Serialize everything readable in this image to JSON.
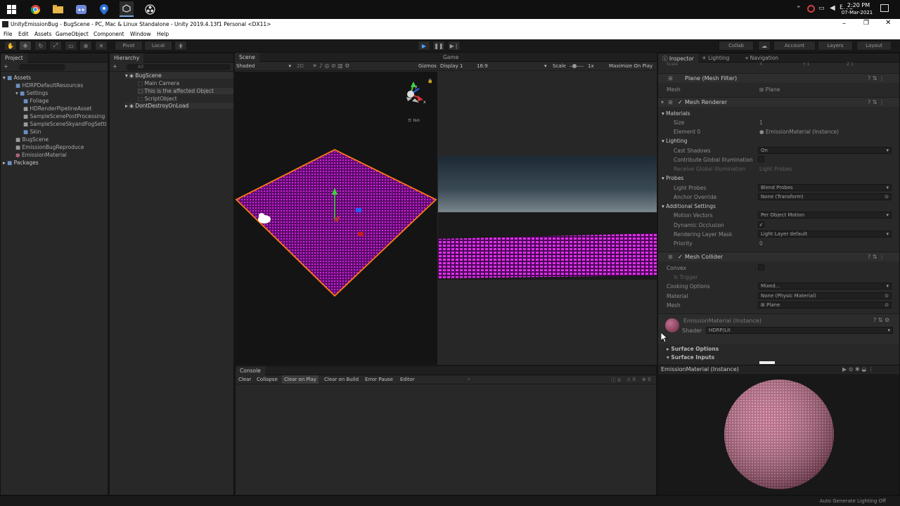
{
  "taskbar": {
    "time": "2:20 PM",
    "date": "07-Mar-2021"
  },
  "window": {
    "title": "UnityEmissionBug - BugScene - PC, Mac & Linux Standalone - Unity 2019.4.13f1 Personal <DX11>"
  },
  "menu": [
    "File",
    "Edit",
    "Assets",
    "GameObject",
    "Component",
    "Window",
    "Help"
  ],
  "toolbar": {
    "pivot": "Pivot",
    "local": "Local",
    "collab": "Collab",
    "account": "Account",
    "layers": "Layers",
    "layout": "Layout"
  },
  "project": {
    "tab": "Project",
    "assets": "Assets",
    "items": [
      "HDRPDefaultResources",
      "Settings",
      "Foliage",
      "HDRenderPipelineAsset",
      "SampleScenePostProcessing",
      "SampleSceneSkyandFogSetti",
      "Skin",
      "BugScene",
      "EmissionBugReproduce",
      "EmissionMaterial"
    ],
    "packages": "Packages"
  },
  "hierarchy": {
    "tab": "Hierarchy",
    "search": "All",
    "scene": "BugScene",
    "items": [
      "Main Camera",
      "This is the affected Object",
      "ScriptObject"
    ],
    "ddol": "DontDestroyOnLoad"
  },
  "scene": {
    "tab": "Scene",
    "mode": "Shaded",
    "dim": "2D",
    "gizmos": "Gizmos",
    "iso": "Iso",
    "axis_x": "x",
    "axis_y": "y"
  },
  "game": {
    "tab": "Game",
    "display": "Display 1",
    "aspect": "16:9",
    "scale": "Scale",
    "scale_val": "1x",
    "maximize": "Maximize On Play"
  },
  "console": {
    "tab": "Console",
    "clear": "Clear",
    "collapse": "Collapse",
    "clear_on_play": "Clear on Play",
    "clear_on_build": "Clear on Build",
    "error_pause": "Error Pause",
    "editor": "Editor",
    "c1": "0",
    "c2": "0",
    "c3": "0"
  },
  "inspector": {
    "tabs": [
      "Inspector",
      "Lighting",
      "Navigation"
    ],
    "top": {
      "x": "X",
      "y": "Y 1",
      "z": "Z 1",
      "scale": "Scale"
    },
    "mesh_filter": {
      "title": "Plane (Mesh Filter)",
      "mesh_label": "Mesh",
      "mesh_val": "Plane"
    },
    "mesh_renderer": {
      "title": "Mesh Renderer",
      "materials": "Materials",
      "size_label": "Size",
      "size_val": "1",
      "elem_label": "Element 0",
      "elem_val": "EmissionMaterial (Instance)",
      "lighting": "Lighting",
      "cast_label": "Cast Shadows",
      "cast_val": "On",
      "contrib_label": "Contribute Global Illumination",
      "receive_label": "Receive Global Illumination",
      "receive_val": "Light Probes",
      "probes": "Probes",
      "lp_label": "Light Probes",
      "lp_val": "Blend Probes",
      "anchor_label": "Anchor Override",
      "anchor_val": "None (Transform)",
      "additional": "Additional Settings",
      "mv_label": "Motion Vectors",
      "mv_val": "Per Object Motion",
      "dyn_label": "Dynamic Occlusion",
      "rlm_label": "Rendering Layer Mask",
      "rlm_val": "Light Layer default",
      "prio_label": "Priority",
      "prio_val": "0"
    },
    "mesh_collider": {
      "title": "Mesh Collider",
      "convex": "Convex",
      "trigger": "Is Trigger",
      "cook_label": "Cooking Options",
      "cook_val": "Mixed...",
      "mat_label": "Material",
      "mat_val": "None (Physic Material)",
      "mesh_label": "Mesh",
      "mesh_val": "Plane"
    },
    "material": {
      "title": "EmissionMaterial (Instance)",
      "shader_label": "Shader",
      "shader_val": "HDRP/Lit",
      "surface_options": "Surface Options",
      "surface_inputs": "Surface Inputs"
    },
    "preview": {
      "title": "EmissionMaterial (Instance)"
    }
  },
  "status": {
    "text": "Auto Generate Lighting Off"
  }
}
